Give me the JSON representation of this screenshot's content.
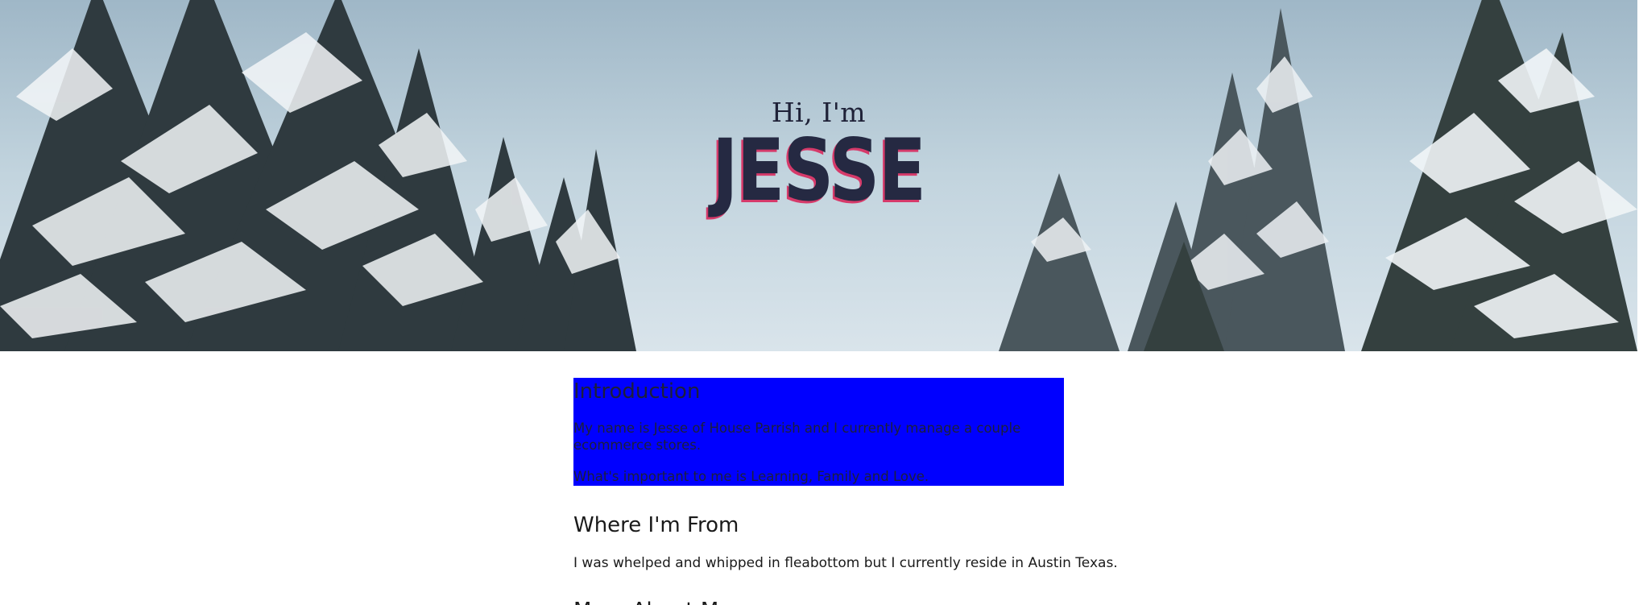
{
  "hero": {
    "greeting": "Hi, I'm",
    "name": "JESSE",
    "name_color": "#252942",
    "name_shadow_color": "#d63a6a"
  },
  "intro": {
    "title": "Introduction",
    "paragraph1": "My name is Jesse of House Parrish and I currently manage a couple ecommerce stores.",
    "paragraph2": "What's important to me is Learning, Family and Love.",
    "background": "#0000ff"
  },
  "where_from": {
    "title": "Where I'm From",
    "text": "I was whelped and whipped in fleabottom but I currently reside in Austin Texas."
  },
  "more": {
    "title": "More About Me"
  }
}
